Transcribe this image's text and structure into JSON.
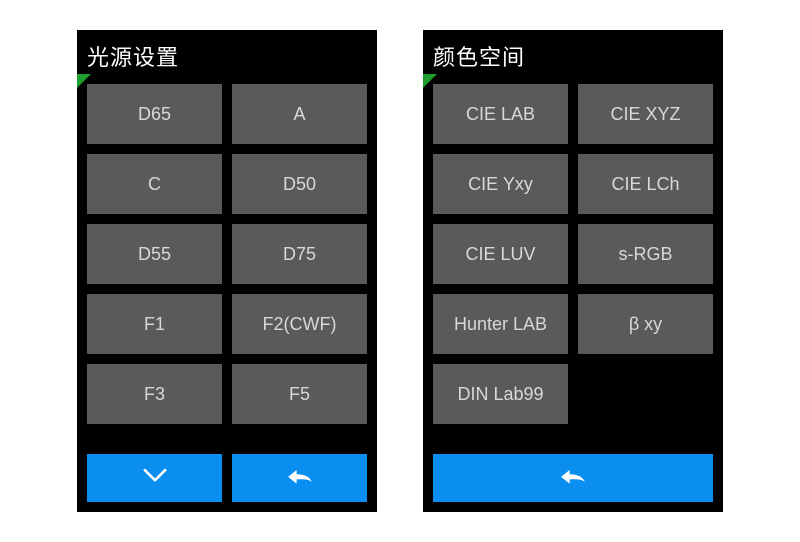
{
  "colors": {
    "accent": "#0a8ef0",
    "corner": "#1e9e2e",
    "option_bg": "#5a5a5a"
  },
  "panels": [
    {
      "id": "light-source",
      "title": "光源设置",
      "options": [
        "D65",
        "A",
        "C",
        "D50",
        "D55",
        "D75",
        "F1",
        "F2(CWF)",
        "F3",
        "F5"
      ],
      "footer": [
        "down",
        "back"
      ]
    },
    {
      "id": "color-space",
      "title": "颜色空间",
      "options": [
        "CIE LAB",
        "CIE XYZ",
        "CIE Yxy",
        "CIE LCh",
        "CIE LUV",
        "s-RGB",
        "Hunter LAB",
        "β xy",
        "DIN Lab99"
      ],
      "footer": [
        "back"
      ]
    }
  ]
}
